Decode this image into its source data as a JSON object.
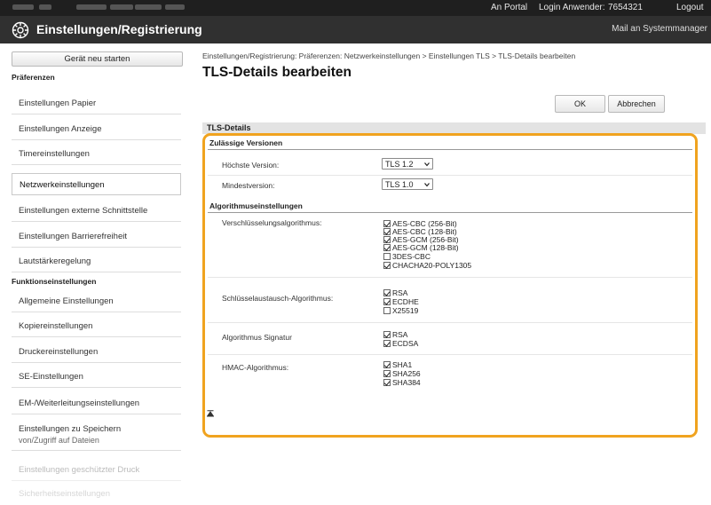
{
  "topbar": {
    "portal_link": "An Portal",
    "login_label": "Login Anwender:",
    "user_id": "7654321",
    "logout": "Logout"
  },
  "header": {
    "title": "Einstellungen/Registrierung",
    "mail_link": "Mail an Systemmanager"
  },
  "sidebar": {
    "restart_label": "Gerät neu starten",
    "section_preferences": "Präferenzen",
    "items_pref": [
      "Einstellungen Papier",
      "Einstellungen Anzeige",
      "Timereinstellungen",
      "Netzwerkeinstellungen",
      "Einstellungen externe Schnittstelle",
      "Einstellungen Barrierefreiheit",
      "Lautstärkeregelung"
    ],
    "section_functions": "Funktionseinstellungen",
    "items_func": [
      "Allgemeine Einstellungen",
      "Kopiereinstellungen",
      "Druckereinstellungen",
      "SE-Einstellungen",
      "EM-/Weiterleitungseinstellungen"
    ],
    "item_storage_line1": "Einstellungen zu Speichern",
    "item_storage_line2": "von/Zugriff auf Dateien",
    "item_secure_print": "Einstellungen geschützter Druck",
    "item_faded_last": "Sicherheitseinstellungen"
  },
  "main": {
    "breadcrumb": "Einstellungen/Registrierung: Präferenzen: Netzwerkeinstellungen > Einstellungen TLS > TLS-Details bearbeiten",
    "title": "TLS-Details bearbeiten",
    "ok_label": "OK",
    "cancel_label": "Abbrechen",
    "panel_title": "TLS-Details",
    "versions_section": "Zulässige Versionen",
    "max_version_label": "Höchste Version:",
    "max_version_value": "TLS 1.2",
    "min_version_label": "Mindestversion:",
    "min_version_value": "TLS 1.0",
    "algo_section": "Algorithmuseinstellungen",
    "encryption_label": "Verschlüsselungsalgorithmus:",
    "encryption_options": [
      {
        "label": "AES-CBC (256-Bit)",
        "checked": true
      },
      {
        "label": "AES-CBC (128-Bit)",
        "checked": true
      },
      {
        "label": "AES-GCM (256-Bit)",
        "checked": true
      },
      {
        "label": "AES-GCM (128-Bit)",
        "checked": true
      },
      {
        "label": "3DES-CBC",
        "checked": false
      },
      {
        "label": "CHACHA20-POLY1305",
        "checked": true
      }
    ],
    "keyexchange_label": "Schlüsselaustausch-Algorithmus:",
    "keyexchange_options": [
      {
        "label": "RSA",
        "checked": true
      },
      {
        "label": "ECDHE",
        "checked": true
      },
      {
        "label": "X25519",
        "checked": false
      }
    ],
    "signature_label": "Algorithmus Signatur",
    "signature_options": [
      {
        "label": "RSA",
        "checked": true
      },
      {
        "label": "ECDSA",
        "checked": true
      }
    ],
    "hmac_label": "HMAC-Algorithmus:",
    "hmac_options": [
      {
        "label": "SHA1",
        "checked": true
      },
      {
        "label": "SHA256",
        "checked": true
      },
      {
        "label": "SHA384",
        "checked": true
      }
    ],
    "back_to_top_icon": "double-up-arrow-icon"
  },
  "colors": {
    "highlight": "#f0a31f",
    "header_bg": "#303030",
    "topbar_bg": "#1f1f1f"
  }
}
